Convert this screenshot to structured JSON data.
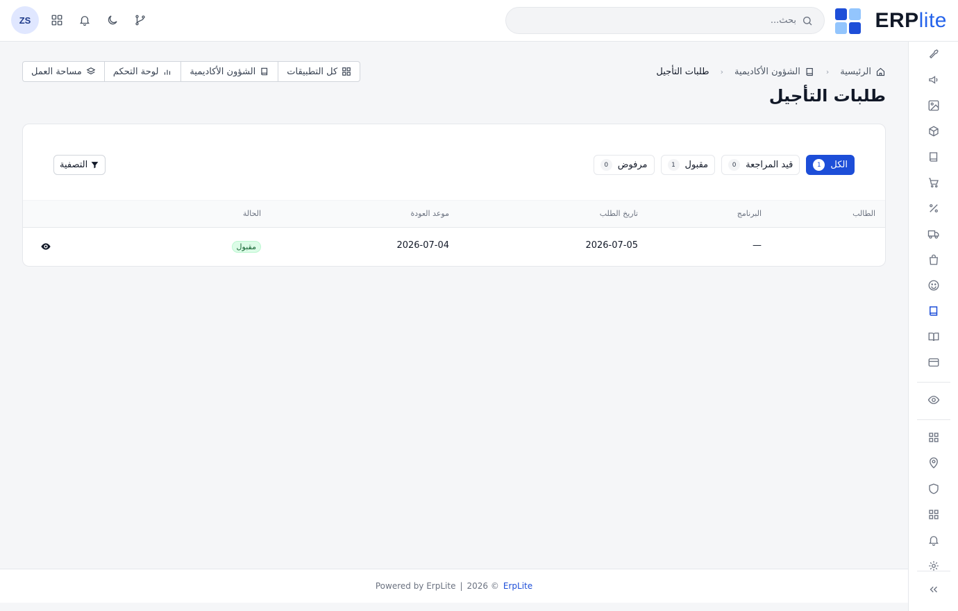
{
  "header": {
    "logo_text_main": "ERP",
    "logo_text_accent": "lite",
    "logo_colors": [
      "#1d4ed8",
      "#93c5fd",
      "#93c5fd",
      "#1d4ed8"
    ],
    "search_placeholder": "بحث...",
    "avatar_initials": "ZS",
    "icons": [
      "git-branch-icon",
      "moon-icon",
      "bell-icon",
      "apps-grid-icon"
    ]
  },
  "sidebar": {
    "items": [
      "tools-icon",
      "megaphone-icon",
      "image-icon",
      "box-icon",
      "book-icon",
      "cart-icon",
      "percent-icon",
      "truck-icon",
      "bag-icon",
      "smile-icon",
      "book-active-icon",
      "book-open-icon",
      "credit-card-icon",
      "eye-icon",
      "grid-icon",
      "map-pin-icon",
      "shield-icon",
      "grid-2-icon",
      "bell-icon",
      "settings-icon",
      "collapse-icon"
    ],
    "active": "book-active-icon"
  },
  "breadcrumb": {
    "home": "الرئيسية",
    "section": "الشؤون الأكاديمية",
    "current": "طلبات التأجيل"
  },
  "page_title": "طلبات التأجيل",
  "quick_links": {
    "all_apps": "كل التطبيقات",
    "academic": "الشؤون الأكاديمية",
    "dashboard": "لوحة التحكم",
    "workspace": "مساحة العمل"
  },
  "tabs": [
    {
      "label": "الكل",
      "count": "1",
      "active": true
    },
    {
      "label": "قيد المراجعة",
      "count": "0",
      "active": false
    },
    {
      "label": "مقبول",
      "count": "1",
      "active": false
    },
    {
      "label": "مرفوض",
      "count": "0",
      "active": false
    }
  ],
  "filter_label": "التصفية",
  "table": {
    "columns": {
      "student": "الطالب",
      "program": "البرنامج",
      "request_date": "تاريخ الطلب",
      "return_date": "موعد العودة",
      "status": "الحالة"
    },
    "rows": [
      {
        "student": "",
        "program": "—",
        "request_date": "2026-07-05",
        "return_date": "2026-07-04",
        "status": "مقبول"
      }
    ]
  },
  "footer": {
    "powered": "Powered by ErpLite",
    "separator": "|",
    "copyright": "2026 ©",
    "brand": "ErpLite"
  },
  "colors": {
    "accent": "#1d4ed8",
    "status_accepted_bg": "#dcfce7",
    "status_accepted_text": "#166534"
  }
}
